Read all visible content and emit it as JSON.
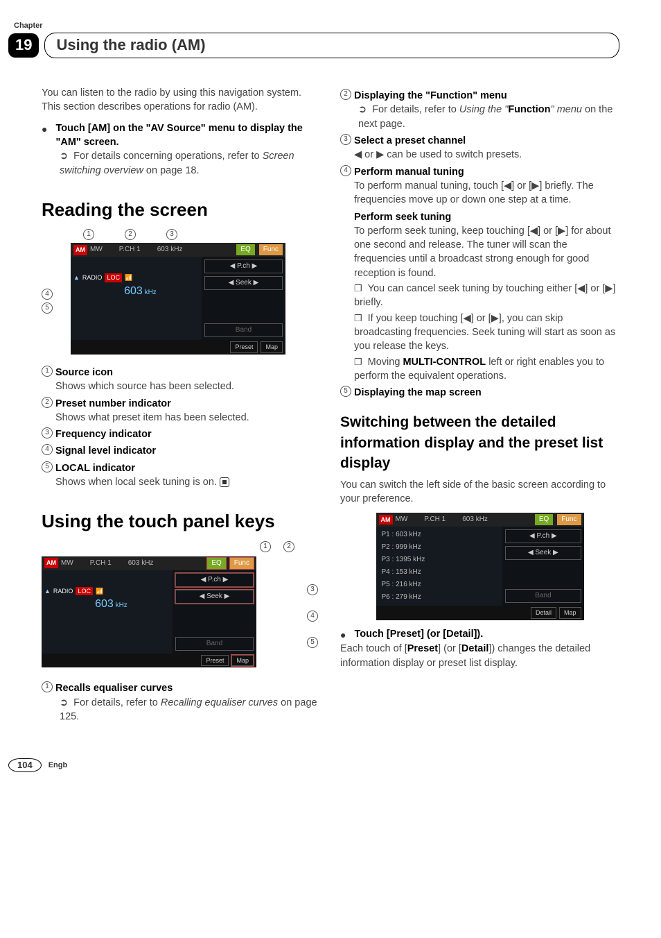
{
  "header": {
    "chapter_label": "Chapter",
    "chapter_number": "19",
    "title": "Using the radio (AM)"
  },
  "left": {
    "intro": "You can listen to the radio by using this navigation system. This section describes operations for radio (AM).",
    "step_bullet": "Touch [AM] on the \"AV Source\" menu to display the \"AM\" screen.",
    "step_ref_prefix": "For details concerning operations, refer to ",
    "step_ref_italic": "Screen switching overview",
    "step_ref_suffix": " on page 18.",
    "h2_reading": "Reading the screen",
    "screen1": {
      "am": "AM",
      "mw": "MW",
      "pch": "P.CH 1",
      "freq_top": "603 kHz",
      "eq": "EQ",
      "func": "Func",
      "pch_btn": "◀  P.ch  ▶",
      "seek_btn": "◀  Seek  ▶",
      "band": "Band",
      "preset": "Preset",
      "map": "Map",
      "radio": "RADIO",
      "loc": "LOC",
      "freq_big": "603",
      "freq_unit": "kHz",
      "c1": "1",
      "c2": "2",
      "c3": "3",
      "c4": "4",
      "c5": "5"
    },
    "legend": {
      "i1_t": "Source icon",
      "i1_d": "Shows which source has been selected.",
      "i2_t": "Preset number indicator",
      "i2_d": "Shows what preset item has been selected.",
      "i3_t": "Frequency indicator",
      "i4_t": "Signal level indicator",
      "i5_t": "LOCAL indicator",
      "i5_d": "Shows when local seek tuning is on."
    },
    "h2_touch": "Using the touch panel keys",
    "screen2": {
      "c1": "1",
      "c2": "2",
      "c3": "3",
      "c4": "4",
      "c5": "5"
    },
    "legend2": {
      "i1_t": "Recalls equaliser curves",
      "i1_ref_prefix": "For details, refer to ",
      "i1_ref_italic": "Recalling equaliser curves",
      "i1_ref_suffix": " on page 125."
    }
  },
  "right": {
    "i2_t": "Displaying the \"Function\" menu",
    "i2_ref_prefix": "For details, refer to ",
    "i2_ref_italic1": "Using the \"",
    "i2_ref_bold": "Function",
    "i2_ref_italic2": "\" menu",
    "i2_ref_suffix": " on the next page.",
    "i3_t": "Select a preset channel",
    "i3_d": "◀ or ▶ can be used to switch presets.",
    "i4_t": "Perform manual tuning",
    "i4_d": "To perform manual tuning, touch [◀] or [▶] briefly. The frequencies move up or down one step at a time.",
    "i4b_t": "Perform seek tuning",
    "i4b_d": "To perform seek tuning, keep touching [◀] or [▶] for about one second and release. The tuner will scan the frequencies until a broadcast strong enough for good reception is found.",
    "note1": "You can cancel seek tuning by touching either [◀] or [▶] briefly.",
    "note2": "If you keep touching [◀] or [▶], you can skip broadcasting frequencies. Seek tuning will start as soon as you release the keys.",
    "note3_pre": "Moving ",
    "note3_bold": "MULTI-CONTROL",
    "note3_post": " left or right enables you to perform the equivalent operations.",
    "i5_t": "Displaying the map screen",
    "h3_switch": "Switching between the detailed information display and the preset list display",
    "switch_para": "You can switch the left side of the basic screen according to your preference.",
    "presets": {
      "p1": "P1  : 603 kHz",
      "p2": "P2  : 999 kHz",
      "p3": "P3  : 1395 kHz",
      "p4": "P4  : 153 kHz",
      "p5": "P5  : 216 kHz",
      "p6": "P6  : 279 kHz",
      "detail": "Detail"
    },
    "touch_preset": "Touch [Preset] (or [Detail]).",
    "touch_preset_desc_pre": "Each touch of [",
    "touch_preset_b1": "Preset",
    "touch_preset_mid": "] (or [",
    "touch_preset_b2": "Detail",
    "touch_preset_desc_post": "]) changes the detailed information display or preset list display."
  },
  "footer": {
    "page": "104",
    "lang": "Engb"
  }
}
